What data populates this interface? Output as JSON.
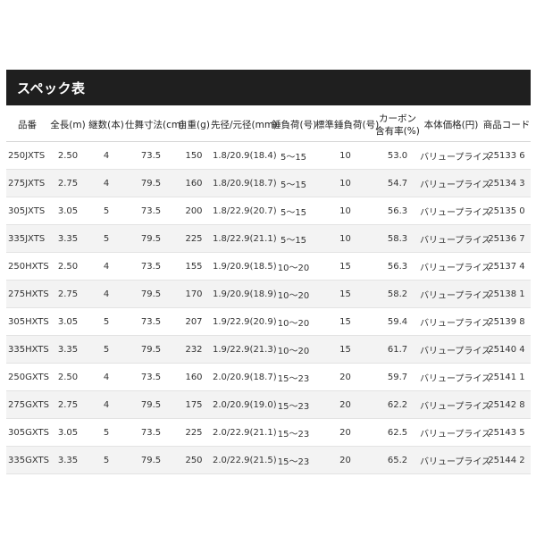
{
  "title": "スペック表",
  "headers": [
    "品番",
    "全長(m)",
    "継数(本)",
    "仕舞寸法(cm)",
    "自重(g)",
    "先径/元径(mm)",
    "錘負荷(号)",
    "標準錘負荷(号)",
    "カーボン含有率(%)",
    "本体価格(円)",
    "商品コード"
  ],
  "header_lines": {
    "carbon_line1": "カーボン",
    "carbon_line2": "含有率(%)"
  },
  "rows": [
    [
      "250JXTS",
      "2.50",
      "4",
      "73.5",
      "150",
      "1.8/20.9(18.4)",
      "5～15",
      "10",
      "53.0",
      "バリュープライス",
      "25133 6"
    ],
    [
      "275JXTS",
      "2.75",
      "4",
      "79.5",
      "160",
      "1.8/20.9(18.7)",
      "5～15",
      "10",
      "54.7",
      "バリュープライス",
      "25134 3"
    ],
    [
      "305JXTS",
      "3.05",
      "5",
      "73.5",
      "200",
      "1.8/22.9(20.7)",
      "5～15",
      "10",
      "56.3",
      "バリュープライス",
      "25135 0"
    ],
    [
      "335JXTS",
      "3.35",
      "5",
      "79.5",
      "225",
      "1.8/22.9(21.1)",
      "5～15",
      "10",
      "58.3",
      "バリュープライス",
      "25136 7"
    ],
    [
      "250HXTS",
      "2.50",
      "4",
      "73.5",
      "155",
      "1.9/20.9(18.5)",
      "10～20",
      "15",
      "56.3",
      "バリュープライス",
      "25137 4"
    ],
    [
      "275HXTS",
      "2.75",
      "4",
      "79.5",
      "170",
      "1.9/20.9(18.9)",
      "10～20",
      "15",
      "58.2",
      "バリュープライス",
      "25138 1"
    ],
    [
      "305HXTS",
      "3.05",
      "5",
      "73.5",
      "207",
      "1.9/22.9(20.9)",
      "10～20",
      "15",
      "59.4",
      "バリュープライス",
      "25139 8"
    ],
    [
      "335HXTS",
      "3.35",
      "5",
      "79.5",
      "232",
      "1.9/22.9(21.3)",
      "10～20",
      "15",
      "61.7",
      "バリュープライス",
      "25140 4"
    ],
    [
      "250GXTS",
      "2.50",
      "4",
      "73.5",
      "160",
      "2.0/20.9(18.7)",
      "15～23",
      "20",
      "59.7",
      "バリュープライス",
      "25141 1"
    ],
    [
      "275GXTS",
      "2.75",
      "4",
      "79.5",
      "175",
      "2.0/20.9(19.0)",
      "15～23",
      "20",
      "62.2",
      "バリュープライス",
      "25142 8"
    ],
    [
      "305GXTS",
      "3.05",
      "5",
      "73.5",
      "225",
      "2.0/22.9(21.1)",
      "15～23",
      "20",
      "62.5",
      "バリュープライス",
      "25143 5"
    ],
    [
      "335GXTS",
      "3.35",
      "5",
      "79.5",
      "250",
      "2.0/22.9(21.5)",
      "15～23",
      "20",
      "65.2",
      "バリュープライス",
      "25144 2"
    ]
  ]
}
